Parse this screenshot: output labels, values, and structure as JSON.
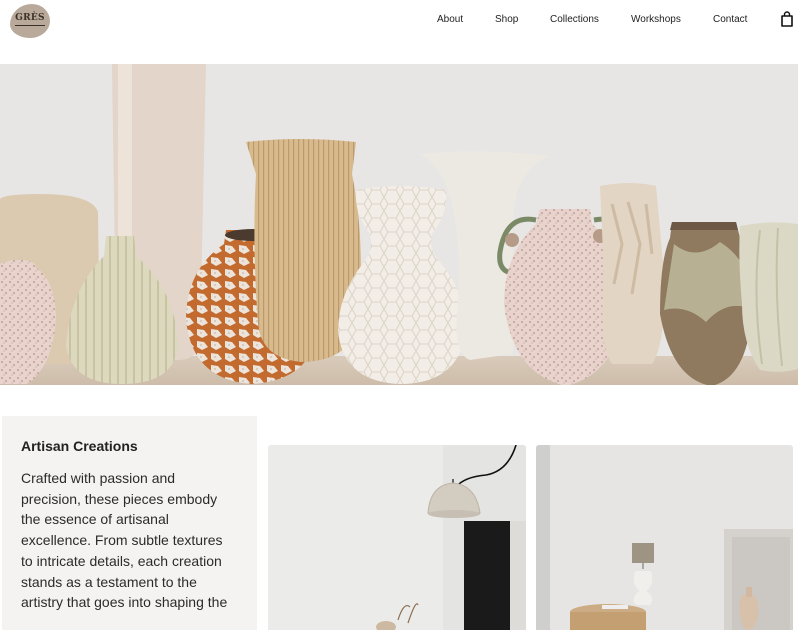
{
  "brand": {
    "logo_text": "GRÈS",
    "logo_icon": "brand-logo"
  },
  "nav": {
    "items": [
      {
        "label": "About"
      },
      {
        "label": "Shop"
      },
      {
        "label": "Collections"
      },
      {
        "label": "Workshops"
      },
      {
        "label": "Contact"
      }
    ],
    "cart_icon": "shopping-bag-icon"
  },
  "hero": {
    "image": "ceramic-vases-photo"
  },
  "feature": {
    "title": "Artisan Creations",
    "body": "Crafted with passion and precision, these pieces embody the essence of artisanal excellence. From subtle textures to intricate details, each creation stands as a testament to the artistry that goes into shaping the"
  },
  "gallery": {
    "images": [
      "interior-pendant-lamp-photo",
      "interior-table-vase-photo"
    ]
  },
  "colors": {
    "background": "#ffffff",
    "card_background": "#f4f3f1",
    "text": "#222222",
    "logo_blob": "#b9a99a"
  }
}
